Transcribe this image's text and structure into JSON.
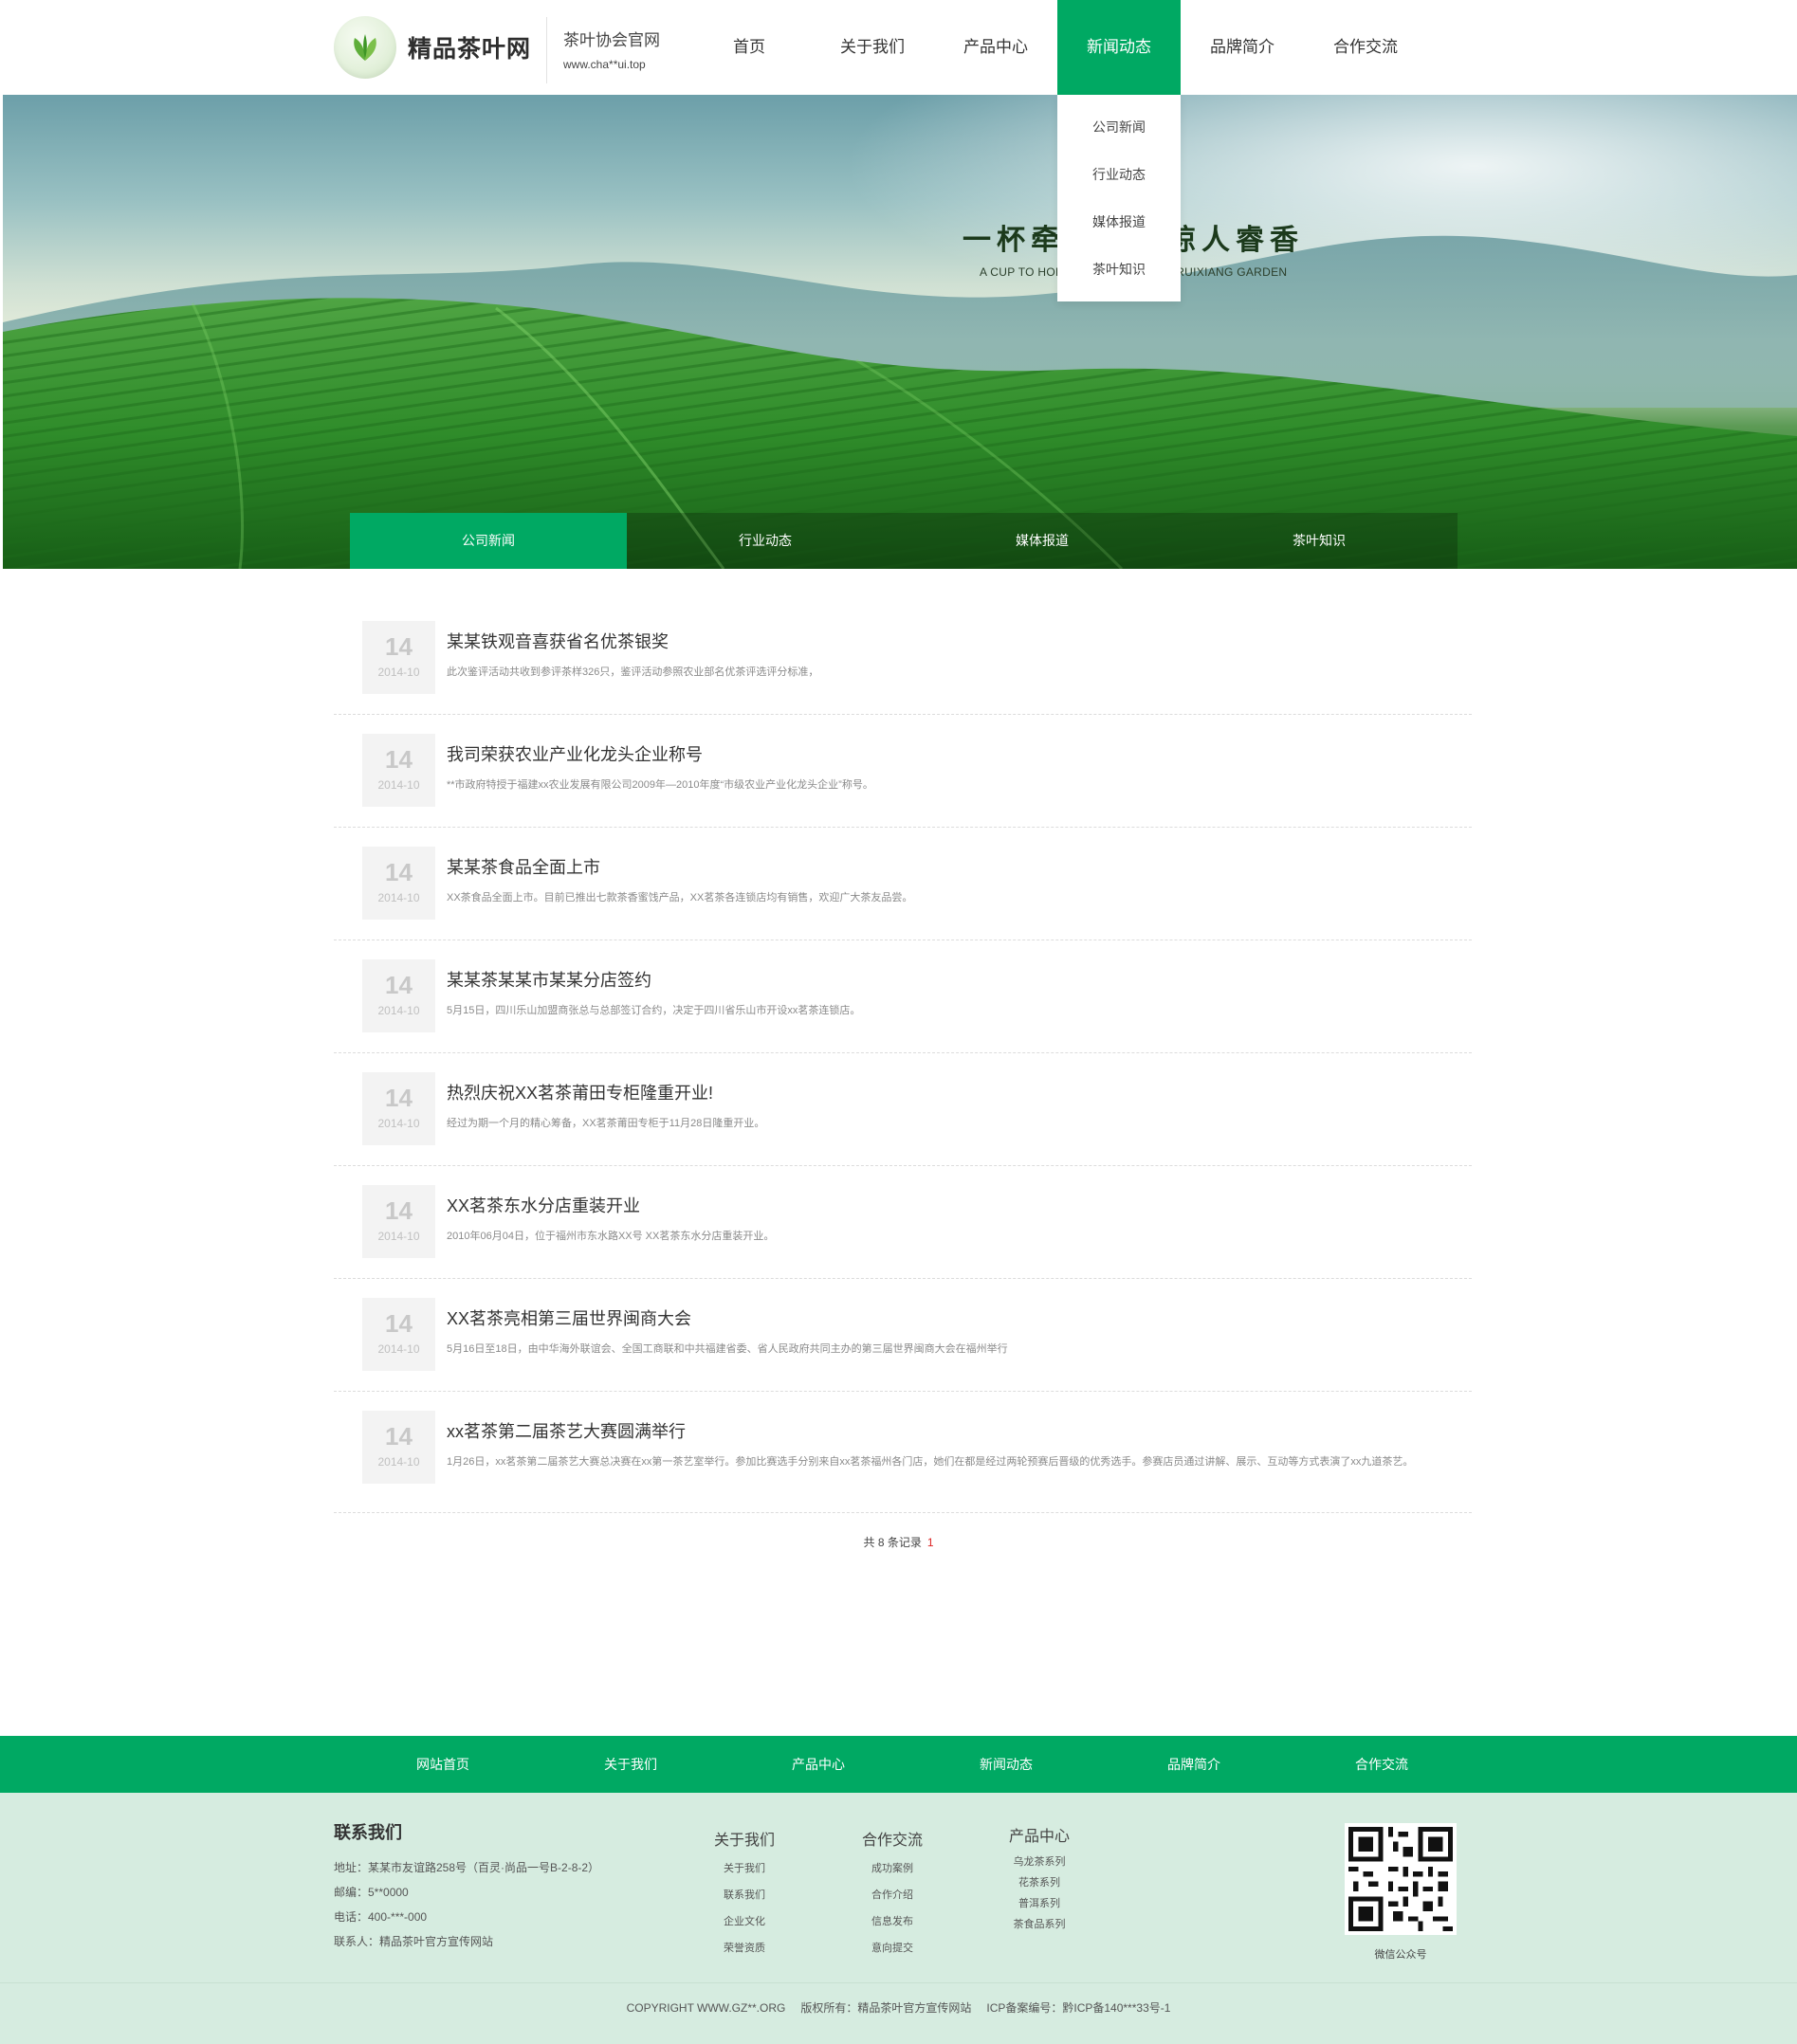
{
  "header": {
    "logo_text": "精品茶叶网",
    "site_name": "茶叶协会官网",
    "site_url": "www.cha**ui.top",
    "nav": [
      {
        "label": "首页"
      },
      {
        "label": "关于我们"
      },
      {
        "label": "产品中心"
      },
      {
        "label": "新闻动态",
        "active": true
      },
      {
        "label": "品牌简介"
      },
      {
        "label": "合作交流"
      }
    ],
    "dropdown": [
      "公司新闻",
      "行业动态",
      "媒体报道",
      "茶叶知识"
    ]
  },
  "banner": {
    "slogan": "一杯牵起一茗惊人睿香",
    "slogan_en": "A CUP TO HOLD OF TEA AMAZING RUIXIANG GARDEN",
    "tabs": [
      {
        "label": "公司新闻",
        "active": true
      },
      {
        "label": "行业动态"
      },
      {
        "label": "媒体报道"
      },
      {
        "label": "茶叶知识"
      }
    ]
  },
  "news": [
    {
      "day": "14",
      "ym": "2014-10",
      "title": "某某铁观音喜获省名优茶银奖",
      "desc": "此次鉴评活动共收到参评茶样326只，鉴评活动参照农业部名优茶评选评分标准，"
    },
    {
      "day": "14",
      "ym": "2014-10",
      "title": "我司荣获农业产业化龙头企业称号",
      "desc": "**市政府特授于福建xx农业发展有限公司2009年—2010年度“市级农业产业化龙头企业”称号。"
    },
    {
      "day": "14",
      "ym": "2014-10",
      "title": "某某茶食品全面上市",
      "desc": " XX茶食品全面上市。目前已推出七款茶香蜜饯产品，XX茗茶各连锁店均有销售，欢迎广大茶友品尝。"
    },
    {
      "day": "14",
      "ym": "2014-10",
      "title": "某某茶某某市某某分店签约",
      "desc": "5月15日，四川乐山加盟商张总与总部签订合约，决定于四川省乐山市开设xx茗茶连锁店。"
    },
    {
      "day": "14",
      "ym": "2014-10",
      "title": "热烈庆祝XX茗茶莆田专柜隆重开业!",
      "desc": "经过为期一个月的精心筹备，XX茗茶莆田专柜于11月28日隆重开业。"
    },
    {
      "day": "14",
      "ym": "2014-10",
      "title": "XX茗茶东水分店重装开业",
      "desc": "2010年06月04日，位于福州市东水路XX号 XX茗茶东水分店重装开业。"
    },
    {
      "day": "14",
      "ym": "2014-10",
      "title": "XX茗茶亮相第三届世界闽商大会",
      "desc": "5月16日至18日，由中华海外联谊会、全国工商联和中共福建省委、省人民政府共同主办的第三届世界闽商大会在福州举行"
    },
    {
      "day": "14",
      "ym": "2014-10",
      "title": "xx茗茶第二届茶艺大赛圆满举行",
      "desc": "1月26日，xx茗茶第二届茶艺大赛总决赛在xx第一茶艺室举行。参加比赛选手分别来自xx茗茶福州各门店，她们在都是经过两轮预赛后晋级的优秀选手。参赛店员通过讲解、展示、互动等方式表演了xx九道茶艺。"
    }
  ],
  "pager": {
    "total": "共 8 条记录",
    "page": "1"
  },
  "footer_nav": [
    "网站首页",
    "关于我们",
    "产品中心",
    "新闻动态",
    "品牌简介",
    "合作交流"
  ],
  "contact": {
    "title": "联系我们",
    "lines": [
      "地址：某某市友谊路258号（百灵·尚品一号B-2-8-2）",
      "邮编：5**0000",
      "电话：400-***-000",
      "联系人：精品茶叶官方宣传网站"
    ]
  },
  "footer_cols": [
    {
      "head": "关于我们",
      "items": [
        "关于我们",
        "联系我们",
        "企业文化",
        "荣誉资质"
      ]
    },
    {
      "head": "合作交流",
      "items": [
        "成功案例",
        "合作介绍",
        "信息发布",
        "意向提交"
      ]
    },
    {
      "head": "产品中心",
      "items": [
        "乌龙茶系列",
        "花茶系列",
        "普洱系列",
        "茶食品系列"
      ]
    }
  ],
  "qr_label": "微信公众号",
  "copyright": {
    "c1": "COPYRIGHT WWW.GZ**.ORG",
    "c2": "版权所有：精品茶叶官方宣传网站",
    "c3": "ICP备案编号：黔ICP备140***33号-1"
  },
  "colors": {
    "brand": "#00a963",
    "footer_bg": "#d6ece0"
  }
}
